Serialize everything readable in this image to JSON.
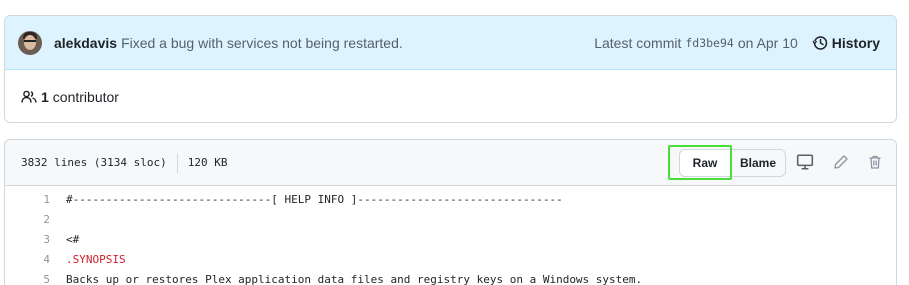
{
  "commit": {
    "author": "alekdavis",
    "message": "Fixed a bug with services not being restarted.",
    "latest_label": "Latest commit",
    "sha": "fd3be94",
    "date": "on Apr 10",
    "history_label": "History"
  },
  "contributors": {
    "count": "1",
    "label": "contributor"
  },
  "file": {
    "lines_info": "3832 lines (3134 sloc)",
    "size": "120 KB",
    "raw_label": "Raw",
    "blame_label": "Blame",
    "icons": [
      "desktop-icon",
      "pencil-icon",
      "trash-icon"
    ]
  },
  "code_lines": [
    {
      "num": "1",
      "text": "#------------------------------[ HELP INFO ]-------------------------------"
    },
    {
      "num": "2",
      "text": ""
    },
    {
      "num": "3",
      "text": "<#"
    },
    {
      "num": "4",
      "text": ".SYNOPSIS"
    },
    {
      "num": "5",
      "text": "Backs up or restores Plex application data files and registry keys on a Windows system."
    }
  ],
  "colors": {
    "commit_bar_bg": "#ddf4ff",
    "highlight": "#4ade3a",
    "keyword": "#cf222e"
  }
}
